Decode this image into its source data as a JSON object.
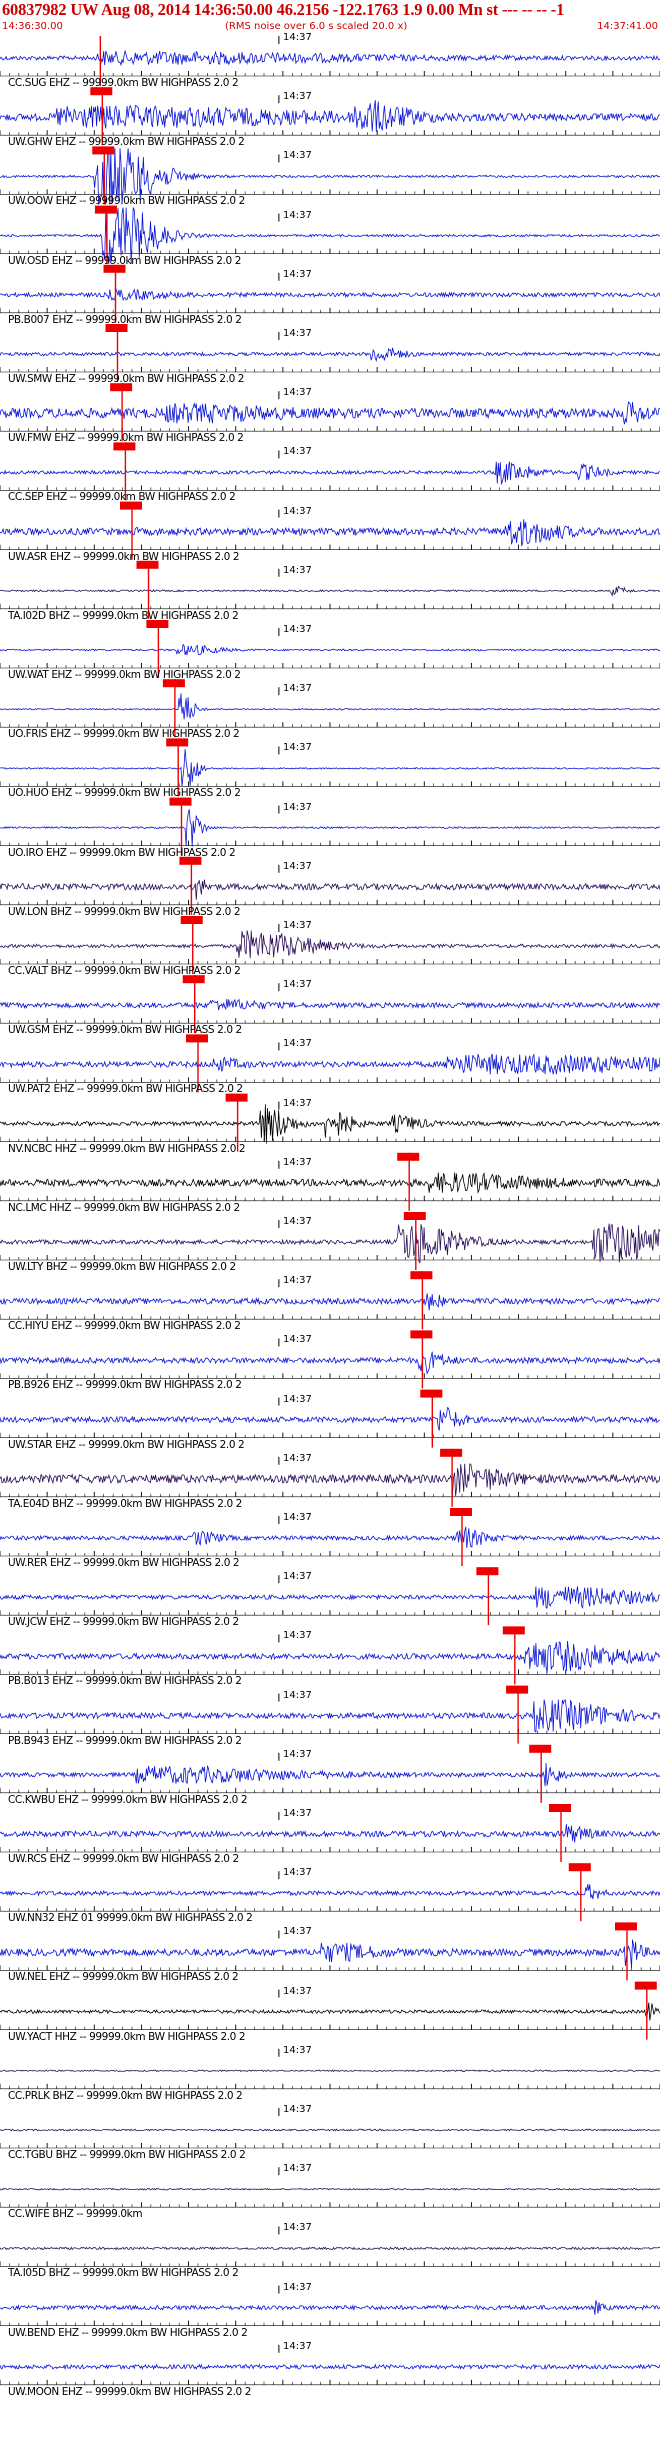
{
  "header": {
    "title": "60837982 UW Aug 08, 2014 14:36:50.00   46.2156 -122.1763  1.9 0.00 Mn st --- -- --  -1",
    "start_time": "14:36:30.00",
    "end_time": "14:37:41.00",
    "subtitle": "(RMS noise over 6.0 s scaled 20.0 x)"
  },
  "colors": {
    "title": "#cc0000",
    "pick": "#ee0000",
    "trace_blue": "#0a14d8",
    "trace_navy": "#2a0f5a",
    "trace_black": "#000000",
    "grid": "#000000"
  },
  "minute_tick_label": "14:37",
  "traces": [
    {
      "label": "CC.SUG EHZ -- 99999.0km BW  HIGHPASS  2.0  2",
      "color": "blue",
      "pick": 0.152,
      "events": [
        [
          0.22,
          0.5,
          0.35
        ]
      ],
      "noise": 0.15
    },
    {
      "label": "UW.GHW EHZ -- 99999.0km BW  HIGHPASS  2.0  2",
      "color": "blue",
      "pick": 0.155,
      "events": [
        [
          0.16,
          0.5,
          0.6
        ],
        [
          0.55,
          0.1,
          0.9
        ]
      ],
      "noise": 0.25
    },
    {
      "label": "UW.OOW EHZ -- 99999.0km BW  HIGHPASS  2.0  2",
      "color": "blue",
      "pick": 0.158,
      "events": [
        [
          0.16,
          0.12,
          2.5
        ]
      ],
      "noise": 0.08
    },
    {
      "label": "UW.OSD EHZ -- 99999.0km BW  HIGHPASS  2.0  2",
      "color": "blue",
      "pick": 0.162,
      "events": [
        [
          0.17,
          0.1,
          2.5
        ]
      ],
      "noise": 0.08
    },
    {
      "label": "PB.B007 EHZ -- 99999.0km BW  HIGHPASS  2.0  2",
      "color": "blue",
      "pick": 0.175,
      "events": [
        [
          0.18,
          0.12,
          0.25
        ]
      ],
      "noise": 0.15
    },
    {
      "label": "UW.SMW EHZ -- 99999.0km BW  HIGHPASS  2.0  2",
      "color": "blue",
      "pick": 0.178,
      "events": [
        [
          0.57,
          0.06,
          0.5
        ]
      ],
      "noise": 0.12
    },
    {
      "label": "UW.FMW EHZ -- 99999.0km BW  HIGHPASS  2.0  2",
      "color": "blue",
      "pick": 0.185,
      "events": [
        [
          0.28,
          0.2,
          0.4
        ],
        [
          0.95,
          0.05,
          0.5
        ]
      ],
      "noise": 0.35
    },
    {
      "label": "CC.SEP EHZ -- 99999.0km BW  HIGHPASS  2.0  2",
      "color": "blue",
      "pick": 0.19,
      "events": [
        [
          0.76,
          0.07,
          0.7
        ],
        [
          0.88,
          0.05,
          0.5
        ]
      ],
      "noise": 0.12
    },
    {
      "label": "UW.ASR EHZ -- 99999.0km BW  HIGHPASS  2.0  2",
      "color": "blue",
      "pick": 0.2,
      "events": [
        [
          0.78,
          0.1,
          0.8
        ]
      ],
      "noise": 0.25
    },
    {
      "label": "TA.I02D BHZ -- 99999.0km BW  HIGHPASS  2.0  2",
      "color": "navy",
      "pick": 0.225,
      "events": [
        [
          0.93,
          0.03,
          0.3
        ]
      ],
      "noise": 0.06
    },
    {
      "label": "UW.WAT EHZ -- 99999.0km BW  HIGHPASS  2.0  2",
      "color": "blue",
      "pick": 0.24,
      "events": [
        [
          0.28,
          0.08,
          0.35
        ]
      ],
      "noise": 0.06
    },
    {
      "label": "UO.FRIS EHZ -- 99999.0km BW  HIGHPASS  2.0  2",
      "color": "blue",
      "pick": 0.265,
      "events": [
        [
          0.275,
          0.03,
          1.2
        ]
      ],
      "noise": 0.05
    },
    {
      "label": "UO.HUO EHZ -- 99999.0km BW  HIGHPASS  2.0  2",
      "color": "blue",
      "pick": 0.27,
      "events": [
        [
          0.28,
          0.03,
          1.6
        ]
      ],
      "noise": 0.05
    },
    {
      "label": "UO.IRO EHZ -- 99999.0km BW  HIGHPASS  2.0  2",
      "color": "blue",
      "pick": 0.275,
      "events": [
        [
          0.285,
          0.03,
          1.5
        ]
      ],
      "noise": 0.06
    },
    {
      "label": "UW.LON BHZ -- 99999.0km BW  HIGHPASS  2.0  2",
      "color": "navy",
      "pick": 0.29,
      "events": [
        [
          0.3,
          0.02,
          0.6
        ]
      ],
      "noise": 0.22
    },
    {
      "label": "CC.VALT BHZ -- 99999.0km BW  HIGHPASS  2.0  2",
      "color": "navy",
      "pick": 0.292,
      "events": [
        [
          0.38,
          0.15,
          1.0
        ]
      ],
      "noise": 0.12
    },
    {
      "label": "UW.GSM EHZ -- 99999.0km BW  HIGHPASS  2.0  2",
      "color": "blue",
      "pick": 0.295,
      "events": [
        [
          0.33,
          0.1,
          0.3
        ]
      ],
      "noise": 0.18
    },
    {
      "label": "UW.PAT2 EHZ -- 99999.0km BW  HIGHPASS  2.0  2",
      "color": "blue",
      "pick": 0.3,
      "events": [
        [
          0.75,
          0.5,
          0.55
        ],
        [
          0.33,
          0.05,
          0.35
        ]
      ],
      "noise": 0.2
    },
    {
      "label": "NV.NCBC HHZ -- 99999.0km BW  HIGHPASS  2.0  2",
      "color": "black",
      "pick": 0.36,
      "events": [
        [
          0.4,
          0.06,
          1.3
        ],
        [
          0.5,
          0.05,
          1.0
        ],
        [
          0.6,
          0.06,
          0.5
        ]
      ],
      "noise": 0.15
    },
    {
      "label": "NC.LMC HHZ -- 99999.0km BW  HIGHPASS  2.0  2",
      "color": "black",
      "pick": 0.62,
      "events": [
        [
          0.68,
          0.2,
          0.5
        ]
      ],
      "noise": 0.25
    },
    {
      "label": "UW.LTY BHZ -- 99999.0km BW  HIGHPASS  2.0  2",
      "color": "navy",
      "pick": 0.63,
      "events": [
        [
          0.62,
          0.12,
          1.3
        ],
        [
          0.92,
          0.15,
          1.4
        ]
      ],
      "noise": 0.15
    },
    {
      "label": "CC.HIYU EHZ -- 99999.0km BW  HIGHPASS  2.0  2",
      "color": "blue",
      "pick": 0.64,
      "events": [
        [
          0.65,
          0.03,
          0.5
        ]
      ],
      "noise": 0.2
    },
    {
      "label": "PB.B926 EHZ -- 99999.0km BW  HIGHPASS  2.0  2",
      "color": "blue",
      "pick": 0.64,
      "events": [
        [
          0.64,
          0.05,
          0.6
        ]
      ],
      "noise": 0.2
    },
    {
      "label": "UW.STAR EHZ -- 99999.0km BW  HIGHPASS  2.0  2",
      "color": "blue",
      "pick": 0.655,
      "events": [
        [
          0.67,
          0.04,
          0.8
        ]
      ],
      "noise": 0.2
    },
    {
      "label": "TA.E04D BHZ -- 99999.0km BW  HIGHPASS  2.0  2",
      "color": "navy",
      "pick": 0.685,
      "events": [
        [
          0.7,
          0.1,
          0.8
        ]
      ],
      "noise": 0.3
    },
    {
      "label": "UW.RER EHZ -- 99999.0km BW  HIGHPASS  2.0  2",
      "color": "blue",
      "pick": 0.7,
      "events": [
        [
          0.7,
          0.06,
          0.6
        ],
        [
          0.3,
          0.05,
          0.4
        ]
      ],
      "noise": 0.15
    },
    {
      "label": "UW.JCW EHZ -- 99999.0km BW  HIGHPASS  2.0  2",
      "color": "blue",
      "pick": 0.74,
      "events": [
        [
          0.84,
          0.2,
          0.7
        ]
      ],
      "noise": 0.15
    },
    {
      "label": "PB.B013 EHZ -- 99999.0km BW  HIGHPASS  2.0  2",
      "color": "blue",
      "pick": 0.78,
      "events": [
        [
          0.82,
          0.18,
          1.0
        ]
      ],
      "noise": 0.2
    },
    {
      "label": "PB.B943 EHZ -- 99999.0km BW  HIGHPASS  2.0  2",
      "color": "blue",
      "pick": 0.785,
      "events": [
        [
          0.83,
          0.15,
          1.0
        ]
      ],
      "noise": 0.2
    },
    {
      "label": "CC.KWBU EHZ -- 99999.0km BW  HIGHPASS  2.0  2",
      "color": "blue",
      "pick": 0.82,
      "events": [
        [
          0.83,
          0.03,
          0.7
        ],
        [
          0.25,
          0.3,
          0.5
        ]
      ],
      "noise": 0.15
    },
    {
      "label": "UW.RCS EHZ -- 99999.0km BW  HIGHPASS  2.0  2",
      "color": "blue",
      "pick": 0.85,
      "events": [
        [
          0.86,
          0.05,
          0.5
        ]
      ],
      "noise": 0.2
    },
    {
      "label": "UW.NN32 EHZ 01 99999.0km BW  HIGHPASS  2.0  2",
      "color": "blue",
      "pick": 0.88,
      "events": [
        [
          0.89,
          0.03,
          0.5
        ]
      ],
      "noise": 0.15
    },
    {
      "label": "UW.NEL EHZ -- 99999.0km BW  HIGHPASS  2.0  2",
      "color": "blue",
      "pick": 0.95,
      "events": [
        [
          0.95,
          0.03,
          0.9
        ],
        [
          0.5,
          0.1,
          0.5
        ]
      ],
      "noise": 0.25
    },
    {
      "label": "UW.YACT HHZ -- 99999.0km BW  HIGHPASS  2.0  2",
      "color": "black",
      "pick": 0.98,
      "events": [
        [
          0.98,
          0.02,
          0.6
        ]
      ],
      "noise": 0.12
    },
    {
      "label": "CC.PRLK BHZ -- 99999.0km BW  HIGHPASS  2.0  2",
      "color": "navy",
      "pick": null,
      "events": [],
      "noise": 0.05
    },
    {
      "label": "CC.TGBU BHZ -- 99999.0km BW  HIGHPASS  2.0  2",
      "color": "navy",
      "pick": null,
      "events": [],
      "noise": 0.06
    },
    {
      "label": "CC.WIFE BHZ -- 99999.0km",
      "color": "navy",
      "pick": null,
      "events": [],
      "noise": 0.05
    },
    {
      "label": "TA.I05D BHZ -- 99999.0km BW  HIGHPASS  2.0  2",
      "color": "navy",
      "pick": null,
      "events": [],
      "noise": 0.08
    },
    {
      "label": "UW.BEND EHZ -- 99999.0km BW  HIGHPASS  2.0  2",
      "color": "blue",
      "pick": null,
      "events": [
        [
          0.9,
          0.02,
          0.4
        ]
      ],
      "noise": 0.15
    },
    {
      "label": "UW.MOON EHZ -- 99999.0km BW  HIGHPASS  2.0  2",
      "color": "blue",
      "pick": null,
      "events": [],
      "noise": 0.15
    }
  ]
}
